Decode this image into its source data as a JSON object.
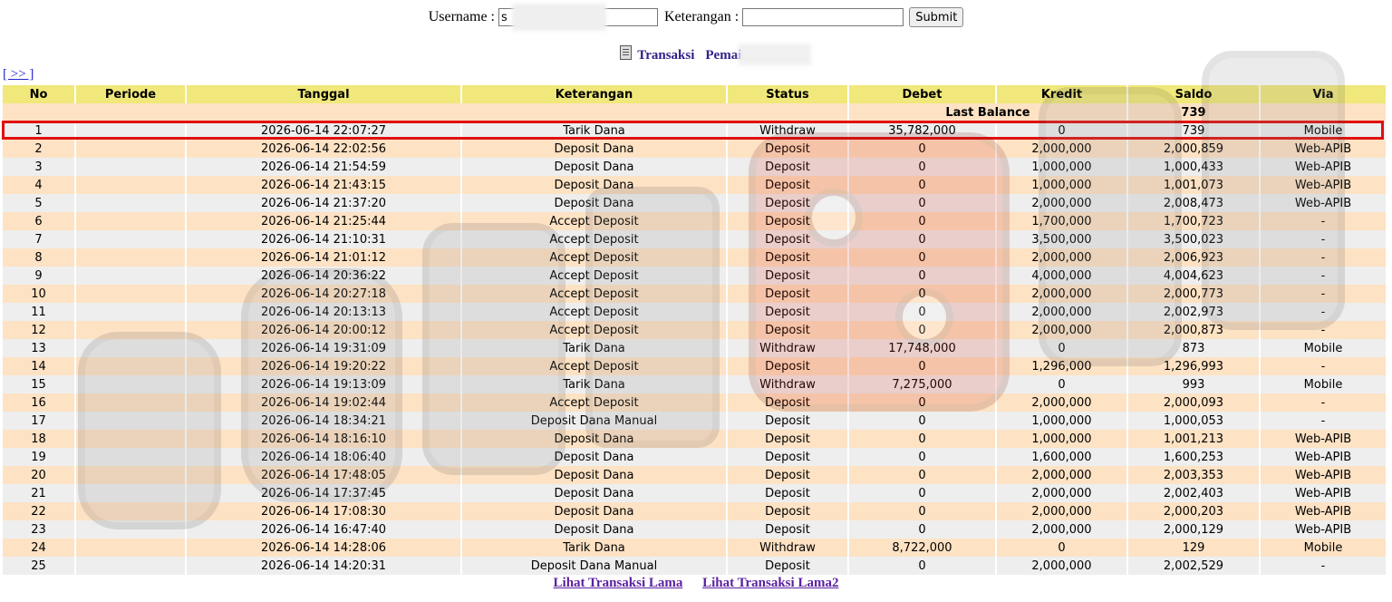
{
  "form": {
    "username_label": "Username :",
    "username_value": "s",
    "keterangan_label": "Keterangan :",
    "keterangan_value": "",
    "submit_label": "Submit"
  },
  "title": {
    "transaksi": "Transaksi",
    "pemain_label": "Pemain : se"
  },
  "nav": {
    "next_label": "[ >> ]"
  },
  "table": {
    "headers": [
      "No",
      "Periode",
      "Tanggal",
      "Keterangan",
      "Status",
      "Debet",
      "Kredit",
      "Saldo",
      "Via"
    ],
    "last_balance_label": "Last Balance",
    "last_balance_value": "739",
    "rows": [
      {
        "no": "1",
        "periode": "",
        "tanggal": "2026-06-14 22:07:27",
        "keterangan": "Tarik Dana",
        "status": "Withdraw",
        "debet": "35,782,000",
        "kredit": "0",
        "saldo": "739",
        "via": "Mobile"
      },
      {
        "no": "2",
        "periode": "",
        "tanggal": "2026-06-14 22:02:56",
        "keterangan": "Deposit Dana",
        "status": "Deposit",
        "debet": "0",
        "kredit": "2,000,000",
        "saldo": "2,000,859",
        "via": "Web-APIB"
      },
      {
        "no": "3",
        "periode": "",
        "tanggal": "2026-06-14 21:54:59",
        "keterangan": "Deposit Dana",
        "status": "Deposit",
        "debet": "0",
        "kredit": "1,000,000",
        "saldo": "1,000,433",
        "via": "Web-APIB"
      },
      {
        "no": "4",
        "periode": "",
        "tanggal": "2026-06-14 21:43:15",
        "keterangan": "Deposit Dana",
        "status": "Deposit",
        "debet": "0",
        "kredit": "1,000,000",
        "saldo": "1,001,073",
        "via": "Web-APIB"
      },
      {
        "no": "5",
        "periode": "",
        "tanggal": "2026-06-14 21:37:20",
        "keterangan": "Deposit Dana",
        "status": "Deposit",
        "debet": "0",
        "kredit": "2,000,000",
        "saldo": "2,008,473",
        "via": "Web-APIB"
      },
      {
        "no": "6",
        "periode": "",
        "tanggal": "2026-06-14 21:25:44",
        "keterangan": "Accept Deposit",
        "status": "Deposit",
        "debet": "0",
        "kredit": "1,700,000",
        "saldo": "1,700,723",
        "via": "-"
      },
      {
        "no": "7",
        "periode": "",
        "tanggal": "2026-06-14 21:10:31",
        "keterangan": "Accept Deposit",
        "status": "Deposit",
        "debet": "0",
        "kredit": "3,500,000",
        "saldo": "3,500,023",
        "via": "-"
      },
      {
        "no": "8",
        "periode": "",
        "tanggal": "2026-06-14 21:01:12",
        "keterangan": "Accept Deposit",
        "status": "Deposit",
        "debet": "0",
        "kredit": "2,000,000",
        "saldo": "2,006,923",
        "via": "-"
      },
      {
        "no": "9",
        "periode": "",
        "tanggal": "2026-06-14 20:36:22",
        "keterangan": "Accept Deposit",
        "status": "Deposit",
        "debet": "0",
        "kredit": "4,000,000",
        "saldo": "4,004,623",
        "via": "-"
      },
      {
        "no": "10",
        "periode": "",
        "tanggal": "2026-06-14 20:27:18",
        "keterangan": "Accept Deposit",
        "status": "Deposit",
        "debet": "0",
        "kredit": "2,000,000",
        "saldo": "2,000,773",
        "via": "-"
      },
      {
        "no": "11",
        "periode": "",
        "tanggal": "2026-06-14 20:13:13",
        "keterangan": "Accept Deposit",
        "status": "Deposit",
        "debet": "0",
        "kredit": "2,000,000",
        "saldo": "2,002,973",
        "via": "-"
      },
      {
        "no": "12",
        "periode": "",
        "tanggal": "2026-06-14 20:00:12",
        "keterangan": "Accept Deposit",
        "status": "Deposit",
        "debet": "0",
        "kredit": "2,000,000",
        "saldo": "2,000,873",
        "via": "-"
      },
      {
        "no": "13",
        "periode": "",
        "tanggal": "2026-06-14 19:31:09",
        "keterangan": "Tarik Dana",
        "status": "Withdraw",
        "debet": "17,748,000",
        "kredit": "0",
        "saldo": "873",
        "via": "Mobile"
      },
      {
        "no": "14",
        "periode": "",
        "tanggal": "2026-06-14 19:20:22",
        "keterangan": "Accept Deposit",
        "status": "Deposit",
        "debet": "0",
        "kredit": "1,296,000",
        "saldo": "1,296,993",
        "via": "-"
      },
      {
        "no": "15",
        "periode": "",
        "tanggal": "2026-06-14 19:13:09",
        "keterangan": "Tarik Dana",
        "status": "Withdraw",
        "debet": "7,275,000",
        "kredit": "0",
        "saldo": "993",
        "via": "Mobile"
      },
      {
        "no": "16",
        "periode": "",
        "tanggal": "2026-06-14 19:02:44",
        "keterangan": "Accept Deposit",
        "status": "Deposit",
        "debet": "0",
        "kredit": "2,000,000",
        "saldo": "2,000,093",
        "via": "-"
      },
      {
        "no": "17",
        "periode": "",
        "tanggal": "2026-06-14 18:34:21",
        "keterangan": "Deposit Dana Manual",
        "status": "Deposit",
        "debet": "0",
        "kredit": "1,000,000",
        "saldo": "1,000,053",
        "via": "-"
      },
      {
        "no": "18",
        "periode": "",
        "tanggal": "2026-06-14 18:16:10",
        "keterangan": "Deposit Dana",
        "status": "Deposit",
        "debet": "0",
        "kredit": "1,000,000",
        "saldo": "1,001,213",
        "via": "Web-APIB"
      },
      {
        "no": "19",
        "periode": "",
        "tanggal": "2026-06-14 18:06:40",
        "keterangan": "Deposit Dana",
        "status": "Deposit",
        "debet": "0",
        "kredit": "1,600,000",
        "saldo": "1,600,253",
        "via": "Web-APIB"
      },
      {
        "no": "20",
        "periode": "",
        "tanggal": "2026-06-14 17:48:05",
        "keterangan": "Deposit Dana",
        "status": "Deposit",
        "debet": "0",
        "kredit": "2,000,000",
        "saldo": "2,003,353",
        "via": "Web-APIB"
      },
      {
        "no": "21",
        "periode": "",
        "tanggal": "2026-06-14 17:37:45",
        "keterangan": "Deposit Dana",
        "status": "Deposit",
        "debet": "0",
        "kredit": "2,000,000",
        "saldo": "2,002,403",
        "via": "Web-APIB"
      },
      {
        "no": "22",
        "periode": "",
        "tanggal": "2026-06-14 17:08:30",
        "keterangan": "Deposit Dana",
        "status": "Deposit",
        "debet": "0",
        "kredit": "2,000,000",
        "saldo": "2,000,203",
        "via": "Web-APIB"
      },
      {
        "no": "23",
        "periode": "",
        "tanggal": "2026-06-14 16:47:40",
        "keterangan": "Deposit Dana",
        "status": "Deposit",
        "debet": "0",
        "kredit": "2,000,000",
        "saldo": "2,000,129",
        "via": "Web-APIB"
      },
      {
        "no": "24",
        "periode": "",
        "tanggal": "2026-06-14 14:28:06",
        "keterangan": "Tarik Dana",
        "status": "Withdraw",
        "debet": "8,722,000",
        "kredit": "0",
        "saldo": "129",
        "via": "Mobile"
      },
      {
        "no": "25",
        "periode": "",
        "tanggal": "2026-06-14 14:20:31",
        "keterangan": "Deposit Dana Manual",
        "status": "Deposit",
        "debet": "0",
        "kredit": "2,000,000",
        "saldo": "2,002,529",
        "via": "-"
      }
    ]
  },
  "footer": {
    "link1": "Lihat Transaksi Lama",
    "link2": "Lihat Transaksi Lama2"
  },
  "colors": {
    "header_bg": "#f0e87a",
    "row_odd_bg": "#fde2c4",
    "row_even_bg": "#eeeeee",
    "withdraw": "#d02020",
    "deposit": "#e0103a",
    "amount_purple": "#6a2bcc",
    "highlight_border": "#e01010"
  }
}
